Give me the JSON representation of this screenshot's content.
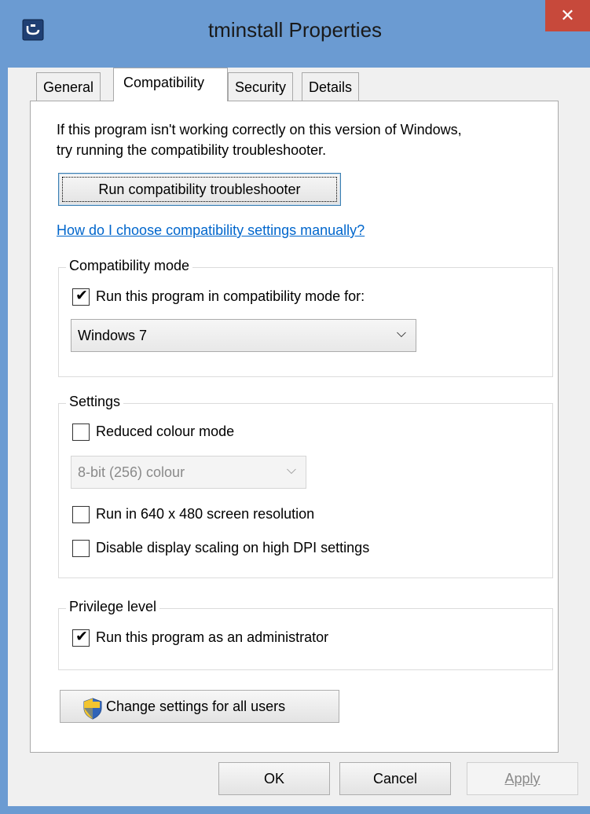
{
  "window": {
    "title": "tminstall Properties",
    "close_glyph": "✕"
  },
  "tabs": [
    {
      "label": "General",
      "active": false
    },
    {
      "label": "Compatibility",
      "active": true
    },
    {
      "label": "Security",
      "active": false
    },
    {
      "label": "Details",
      "active": false
    }
  ],
  "compat": {
    "intro_line1": "If this program isn't working correctly on this version of Windows,",
    "intro_line2": "try running the compatibility troubleshooter.",
    "troubleshooter_button": "Run compatibility troubleshooter",
    "help_link": "How do I choose compatibility settings manually?"
  },
  "compat_mode": {
    "group_label": "Compatibility mode",
    "checkbox_label": "Run this program in compatibility mode for:",
    "checked": true,
    "selected_os": "Windows 7"
  },
  "settings": {
    "group_label": "Settings",
    "reduced_colour_label": "Reduced colour mode",
    "reduced_colour_checked": false,
    "colour_depth_value": "8-bit (256) colour",
    "resolution_label": "Run in 640 x 480 screen resolution",
    "resolution_checked": false,
    "dpi_label": "Disable display scaling on high DPI settings",
    "dpi_checked": false
  },
  "privilege": {
    "group_label": "Privilege level",
    "admin_label": "Run this program as an administrator",
    "admin_checked": true
  },
  "all_users_button": "Change settings for all users",
  "footer": {
    "ok": "OK",
    "cancel": "Cancel",
    "apply": "Apply"
  },
  "icons": {
    "app": "app-icon",
    "shield": "uac-shield-icon",
    "dropdown": "chevron-down-icon",
    "check": "checkmark-icon"
  },
  "colors": {
    "frame": "#6b9bd2",
    "close_button": "#c7493b",
    "link": "#0066cc",
    "focus_border": "#3c7fb1"
  }
}
